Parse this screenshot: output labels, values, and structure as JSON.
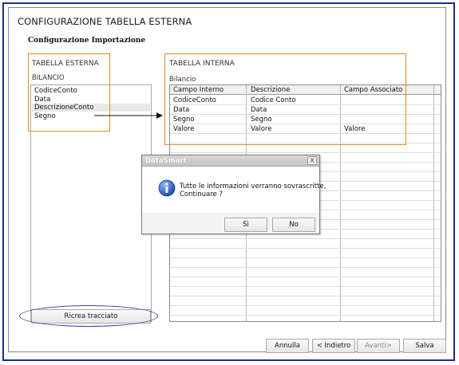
{
  "window": {
    "title": "CONFIGURAZIONE TABELLA ESTERNA"
  },
  "section": {
    "title": "Configurazione Importazione"
  },
  "external_table": {
    "header": "TABELLA ESTERNA",
    "name": "BILANCIO",
    "fields": [
      "CodiceConto",
      "Data",
      "DescrizioneConto",
      "Segno"
    ],
    "selected_index": 2,
    "rebuild_button": "Ricrea tracciato"
  },
  "internal_table": {
    "header": "TABELLA INTERNA",
    "name": "Bilancio",
    "columns": [
      "Campo Interno",
      "Descrizione",
      "Campo Associato"
    ],
    "rows": [
      [
        "CodiceConto",
        "Codice Conto",
        ""
      ],
      [
        "Data",
        "Data",
        ""
      ],
      [
        "Segno",
        "Segno",
        ""
      ],
      [
        "Valore",
        "Valore",
        "Valore"
      ]
    ]
  },
  "footer": {
    "cancel": "Annulla",
    "back": "< Indietro",
    "next": "Avanti>",
    "save": "Salva"
  },
  "dialog": {
    "title": "DataSmart",
    "close": "X",
    "line1": "Tutte le informazioni verranno sovrascritte,",
    "line2": "Continuare ?",
    "yes": "Sì",
    "no": "No",
    "icon": "info-icon"
  },
  "colors": {
    "frame": "#1f2b8c",
    "highlight": "#e0892b",
    "ellipse": "#3a3fa8",
    "info_icon": "#2b62c9"
  }
}
